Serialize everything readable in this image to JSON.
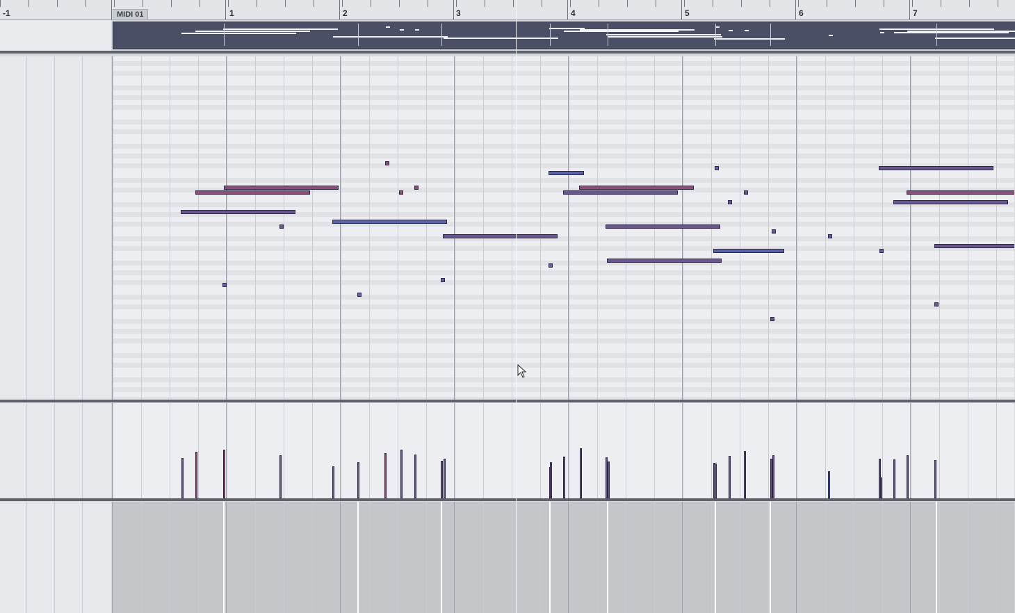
{
  "ruler": {
    "part_label": "MIDI 01",
    "bars": [
      "-1",
      "1",
      "2",
      "3",
      "4",
      "5",
      "6",
      "7"
    ]
  },
  "colors": {
    "note_pink": "#8a4e7a",
    "note_purple": "#6a568f",
    "note_blue": "#5a63a8",
    "overview_bg": "#4b4f66",
    "grid_bg": "#eceef1",
    "controller_bg": "#c4c6ca"
  },
  "icons": {
    "cursor": "mouse-pointer-icon"
  }
}
